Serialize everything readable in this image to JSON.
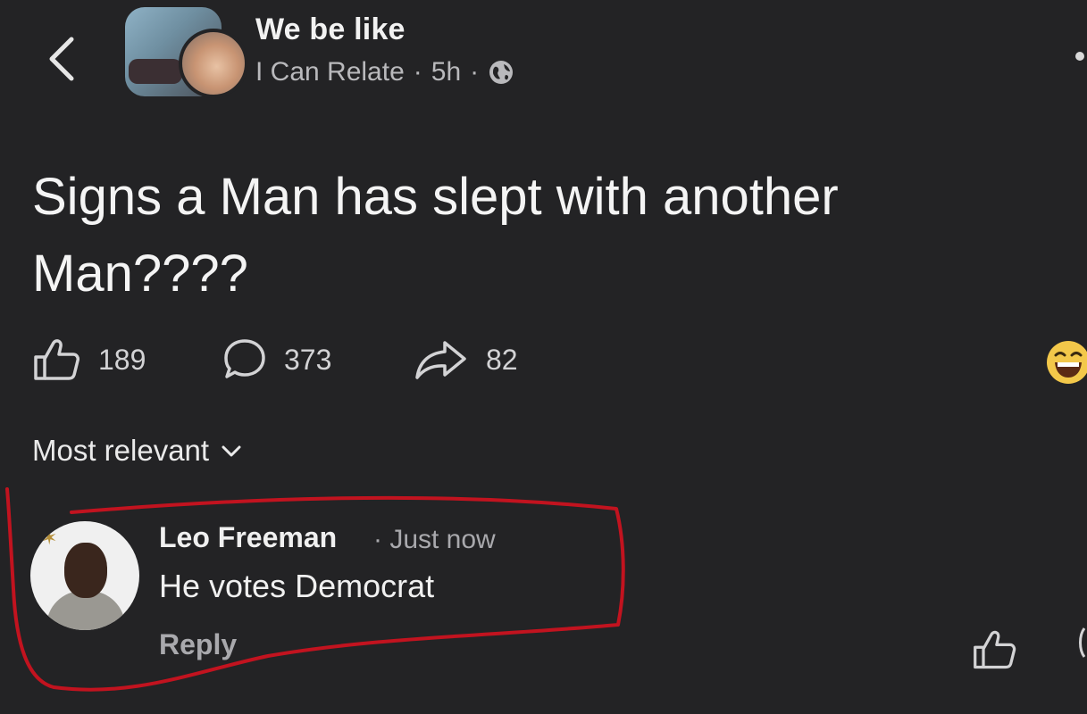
{
  "header": {
    "group_name": "We be like",
    "author": "I Can Relate",
    "separator": "·",
    "time": "5h",
    "privacy_icon": "globe-icon",
    "back_icon": "chevron-left-icon"
  },
  "post": {
    "text": "Signs a Man has slept with another Man????"
  },
  "stats": {
    "likes": "189",
    "comments": "373",
    "shares": "82",
    "like_icon": "thumbs-up-icon",
    "comment_icon": "comment-bubble-icon",
    "share_icon": "share-arrow-icon"
  },
  "comments_section": {
    "sort_label": "Most relevant",
    "sort_icon": "chevron-down-icon"
  },
  "comment": {
    "author": "Leo Freeman",
    "time": "· Just now",
    "text": "He votes Democrat",
    "reply_label": "Reply"
  },
  "colors": {
    "background": "#232325",
    "annotation": "#c2131f",
    "text_primary": "#f0f0f0",
    "text_secondary": "#a9a9ad"
  }
}
